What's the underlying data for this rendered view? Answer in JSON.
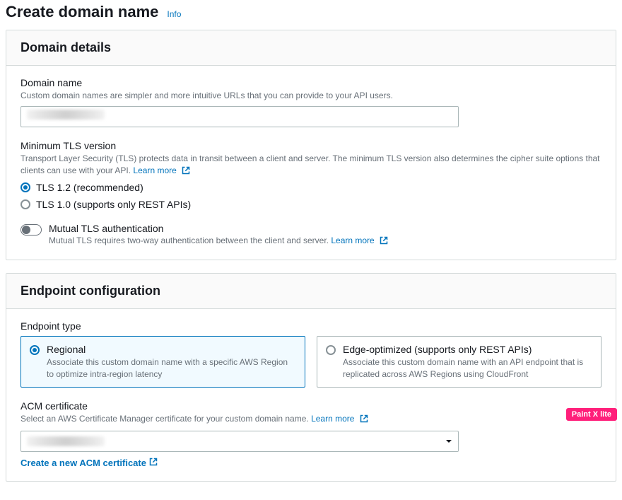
{
  "header": {
    "title": "Create domain name",
    "info_label": "Info"
  },
  "domain_details": {
    "panel_title": "Domain details",
    "domain_name": {
      "label": "Domain name",
      "description": "Custom domain names are simpler and more intuitive URLs that you can provide to your API users.",
      "value": ""
    },
    "min_tls": {
      "label": "Minimum TLS version",
      "description": "Transport Layer Security (TLS) protects data in transit between a client and server. The minimum TLS version also determines the cipher suite options that clients can use with your API.",
      "learn_more": "Learn more",
      "options": [
        {
          "label": "TLS 1.2 (recommended)",
          "selected": true
        },
        {
          "label": "TLS 1.0 (supports only REST APIs)",
          "selected": false
        }
      ]
    },
    "mutual_tls": {
      "label": "Mutual TLS authentication",
      "description": "Mutual TLS requires two-way authentication between the client and server.",
      "learn_more": "Learn more",
      "enabled": false
    }
  },
  "endpoint_config": {
    "panel_title": "Endpoint configuration",
    "endpoint_type": {
      "label": "Endpoint type",
      "options": [
        {
          "title": "Regional",
          "desc": "Associate this custom domain name with a specific AWS Region to optimize intra-region latency",
          "selected": true
        },
        {
          "title": "Edge-optimized (supports only REST APIs)",
          "desc": "Associate this custom domain name with an API endpoint that is replicated across AWS Regions using CloudFront",
          "selected": false
        }
      ]
    },
    "acm": {
      "label": "ACM certificate",
      "description": "Select an AWS Certificate Manager certificate for your custom domain name.",
      "learn_more": "Learn more",
      "selected_value": "",
      "create_link": "Create a new ACM certificate"
    }
  },
  "watermark": "Paint X lite"
}
